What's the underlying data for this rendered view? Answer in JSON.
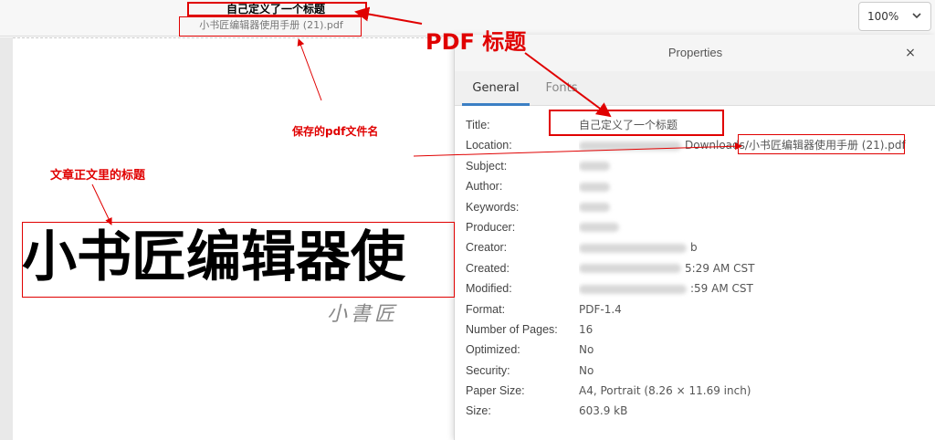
{
  "window": {
    "title": "自己定义了一个标题",
    "filename": "小书匠编辑器使用手册 (21).pdf",
    "zoom": "100%"
  },
  "page": {
    "heading": "小书匠编辑器使",
    "watermark": "小書匠"
  },
  "properties": {
    "title": "Properties",
    "close_icon": "×",
    "tabs": [
      "General",
      "Fonts"
    ],
    "rows": [
      {
        "key": "Title:",
        "value": "自己定义了一个标题"
      },
      {
        "key": "Location:",
        "value": "Downloads/小书匠编辑器使用手册 (21).pdf"
      },
      {
        "key": "Subject:",
        "value": ""
      },
      {
        "key": "Author:",
        "value": ""
      },
      {
        "key": "Keywords:",
        "value": ""
      },
      {
        "key": "Producer:",
        "value": ""
      },
      {
        "key": "Creator:",
        "value": "b"
      },
      {
        "key": "Created:",
        "value": "5:29 AM CST"
      },
      {
        "key": "Modified:",
        "value": ":59 AM CST"
      },
      {
        "key": "Format:",
        "value": "PDF-1.4"
      },
      {
        "key": "Number of Pages:",
        "value": "16"
      },
      {
        "key": "Optimized:",
        "value": "No"
      },
      {
        "key": "Security:",
        "value": "No"
      },
      {
        "key": "Paper Size:",
        "value": "A4, Portrait (8.26 × 11.69 inch)"
      },
      {
        "key": "Size:",
        "value": "603.9 kB"
      }
    ]
  },
  "annotations": {
    "pdf_title": "PDF 标题",
    "saved_filename": "保存的pdf文件名",
    "article_title": "文章正文里的标题",
    "color": "#e00000"
  }
}
